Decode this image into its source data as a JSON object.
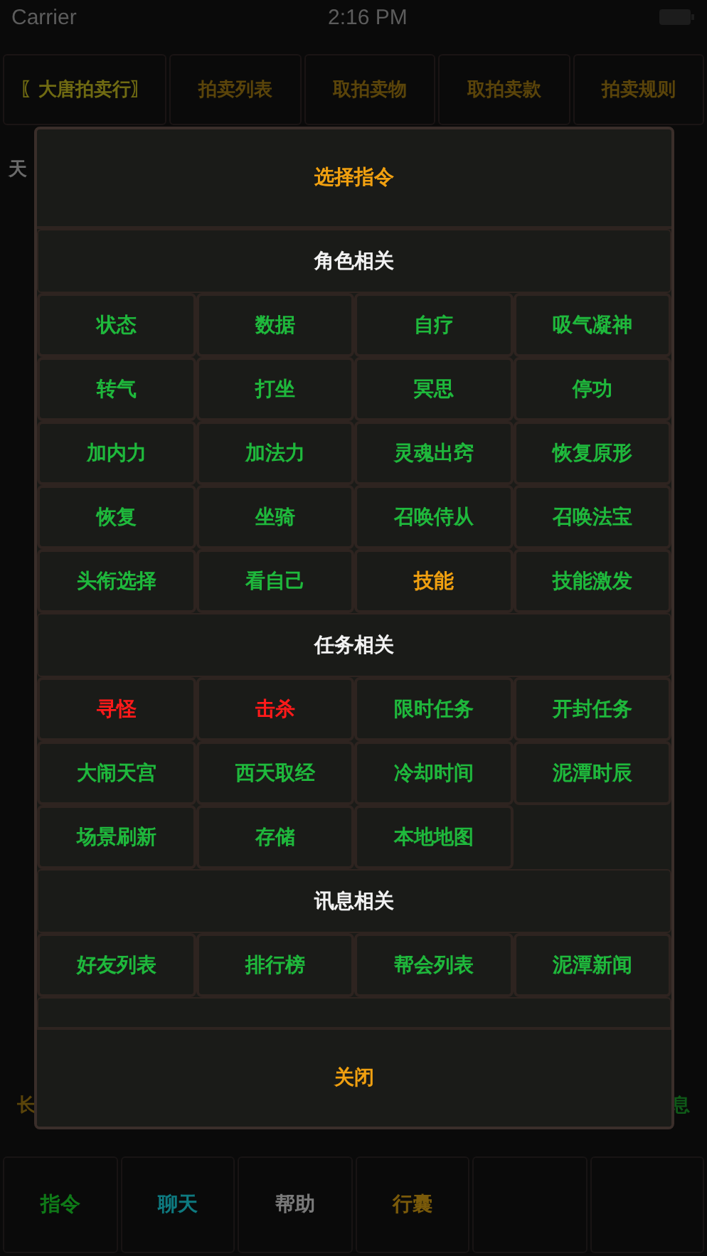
{
  "status_bar": {
    "carrier": "Carrier",
    "time": "2:16 PM"
  },
  "tabs": [
    {
      "label": "〖大唐拍卖行〗",
      "selected": true
    },
    {
      "label": "拍卖列表",
      "selected": false
    },
    {
      "label": "取拍卖物",
      "selected": false
    },
    {
      "label": "取拍卖款",
      "selected": false
    },
    {
      "label": "拍卖规则",
      "selected": false
    }
  ],
  "background_fragments": {
    "top_left": "天",
    "middle_left": "长",
    "middle_right": "息"
  },
  "dialog": {
    "title": "选择指令",
    "sections": [
      {
        "header": "角色相关",
        "items": [
          {
            "label": "状态",
            "color": "#1fb83c"
          },
          {
            "label": "数据",
            "color": "#1fb83c"
          },
          {
            "label": "自疗",
            "color": "#1fb83c"
          },
          {
            "label": "吸气凝神",
            "color": "#1fb83c"
          },
          {
            "label": "转气",
            "color": "#1fb83c"
          },
          {
            "label": "打坐",
            "color": "#1fb83c"
          },
          {
            "label": "冥思",
            "color": "#1fb83c"
          },
          {
            "label": "停功",
            "color": "#1fb83c"
          },
          {
            "label": "加内力",
            "color": "#1fb83c"
          },
          {
            "label": "加法力",
            "color": "#1fb83c"
          },
          {
            "label": "灵魂出窍",
            "color": "#1fb83c"
          },
          {
            "label": "恢复原形",
            "color": "#1fb83c"
          },
          {
            "label": "恢复",
            "color": "#1fb83c"
          },
          {
            "label": "坐骑",
            "color": "#1fb83c"
          },
          {
            "label": "召唤侍从",
            "color": "#1fb83c"
          },
          {
            "label": "召唤法宝",
            "color": "#1fb83c"
          },
          {
            "label": "头衔选择",
            "color": "#1fb83c"
          },
          {
            "label": "看自己",
            "color": "#1fb83c"
          },
          {
            "label": "技能",
            "color": "#f0a010"
          },
          {
            "label": "技能激发",
            "color": "#1fb83c"
          }
        ]
      },
      {
        "header": "任务相关",
        "items": [
          {
            "label": "寻怪",
            "color": "#ff1a1a"
          },
          {
            "label": "击杀",
            "color": "#ff1a1a"
          },
          {
            "label": "限时任务",
            "color": "#1fb83c"
          },
          {
            "label": "开封任务",
            "color": "#1fb83c"
          },
          {
            "label": "大闹天宫",
            "color": "#1fb83c"
          },
          {
            "label": "西天取经",
            "color": "#1fb83c"
          },
          {
            "label": "冷却时间",
            "color": "#1fb83c"
          },
          {
            "label": "泥潭时辰",
            "color": "#1fb83c"
          },
          {
            "label": "场景刷新",
            "color": "#1fb83c"
          },
          {
            "label": "存储",
            "color": "#1fb83c"
          },
          {
            "label": "本地地图",
            "color": "#1fb83c"
          }
        ]
      },
      {
        "header": "讯息相关",
        "items": [
          {
            "label": "好友列表",
            "color": "#1fb83c"
          },
          {
            "label": "排行榜",
            "color": "#1fb83c"
          },
          {
            "label": "帮会列表",
            "color": "#1fb83c"
          },
          {
            "label": "泥潭新闻",
            "color": "#1fb83c"
          }
        ]
      }
    ],
    "close_button": "关闭"
  },
  "bottom_nav": [
    {
      "label": "指令",
      "color": "#0f7a18"
    },
    {
      "label": "聊天",
      "color": "#0e7a80"
    },
    {
      "label": "帮助",
      "color": "#7a7a7a"
    },
    {
      "label": "行囊",
      "color": "#7a5a0a"
    }
  ]
}
